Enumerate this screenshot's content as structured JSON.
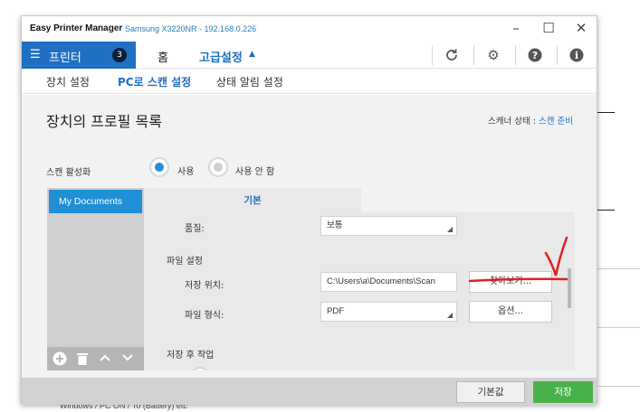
{
  "window": {
    "app_name": "Easy Printer Manager",
    "device": "Samsung X3220NR - 192.168.0.226",
    "controls": {
      "minimize": "–",
      "maximize": "☐",
      "close": "✕"
    }
  },
  "topnav": {
    "printer_label": "프린터",
    "printer_badge": "3",
    "home_label": "홈",
    "advanced_label": "고급설정",
    "advanced_arrow": "▲",
    "icons": [
      "refresh-icon",
      "gear-icon",
      "help-icon",
      "info-icon"
    ]
  },
  "subnav": {
    "tabs": [
      "장치 설정",
      "PC로 스캔 설정",
      "상태 알림 설정"
    ],
    "active_tab": "PC로 스캔 설정"
  },
  "main": {
    "title": "장치의 프로필 목록",
    "scanner_status_label": "스캐너 상태 :",
    "scanner_status_value": "스캔 준비",
    "scan_enable_label": "스캔 활성화",
    "radio_use": "사용",
    "radio_not_use": "사용 안 함",
    "radio_selected": "사용"
  },
  "profiles": {
    "items": [
      "My Documents"
    ],
    "toolbar_icons": [
      "add-icon",
      "trash-icon",
      "up-icon",
      "down-icon"
    ]
  },
  "settings": {
    "tab_label": "기본",
    "quality_label": "품질:",
    "quality_value": "보통",
    "file_settings_label": "파일 설정",
    "save_location_label": "저장 위치:",
    "save_location_value": "C:\\Users\\a\\Documents\\Scan",
    "browse_button": "찾아보기...",
    "file_format_label": "파일 형식:",
    "file_format_value": "PDF",
    "options_button": "옵션...",
    "post_scan_label": "저장 후 작업"
  },
  "footer": {
    "default_button": "기본값",
    "save_button": "저장"
  },
  "background": {
    "footer_text": "Windows / PC ON / To (Battery) etc"
  },
  "colors": {
    "accent": "#1f6fc3",
    "profile_selected": "#1f8fd6",
    "save_green": "#48b24a",
    "annotation_red": "#e02020"
  }
}
